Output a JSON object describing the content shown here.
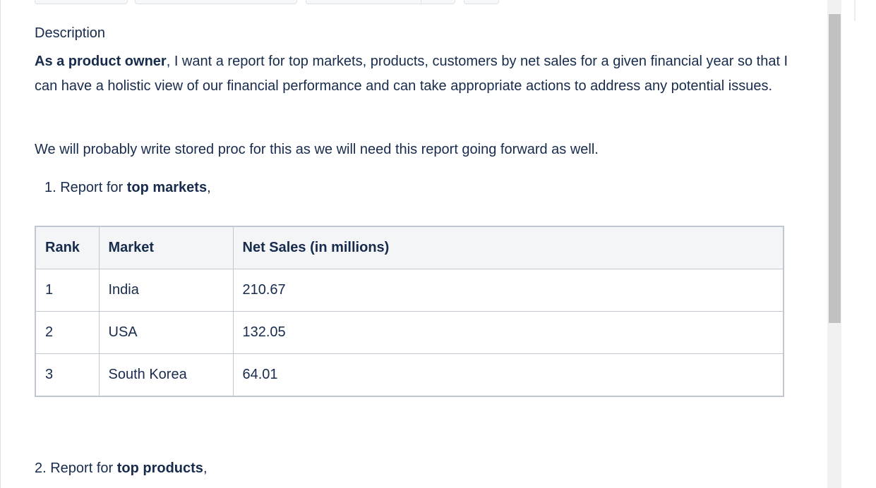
{
  "description": {
    "label": "Description",
    "para1_bold": "As a product owner",
    "para1_rest": ", I want a report for top markets, products, customers by net sales for a given financial year so that I can have a holistic view of our financial performance and can take appropriate actions to address any potential issues.",
    "para2": "We will probably write stored proc for this as we will need this report going forward as well."
  },
  "list": {
    "item1_prefix": "1. Report for ",
    "item1_bold": "top markets",
    "item1_suffix": ",",
    "item2_prefix": "2. Report for ",
    "item2_bold": "top products",
    "item2_suffix": ","
  },
  "markets_table": {
    "headers": [
      "Rank",
      "Market",
      "Net Sales (in millions)"
    ],
    "rows": [
      [
        "1",
        "India",
        "210.67"
      ],
      [
        "2",
        "USA",
        "132.05"
      ],
      [
        "3",
        "South Korea",
        "64.01"
      ]
    ]
  },
  "colors": {
    "text": "#172b4d",
    "table_border": "#c1c7d0",
    "header_bg": "#f4f5f7",
    "scroll_thumb": "#c1c1c1"
  }
}
